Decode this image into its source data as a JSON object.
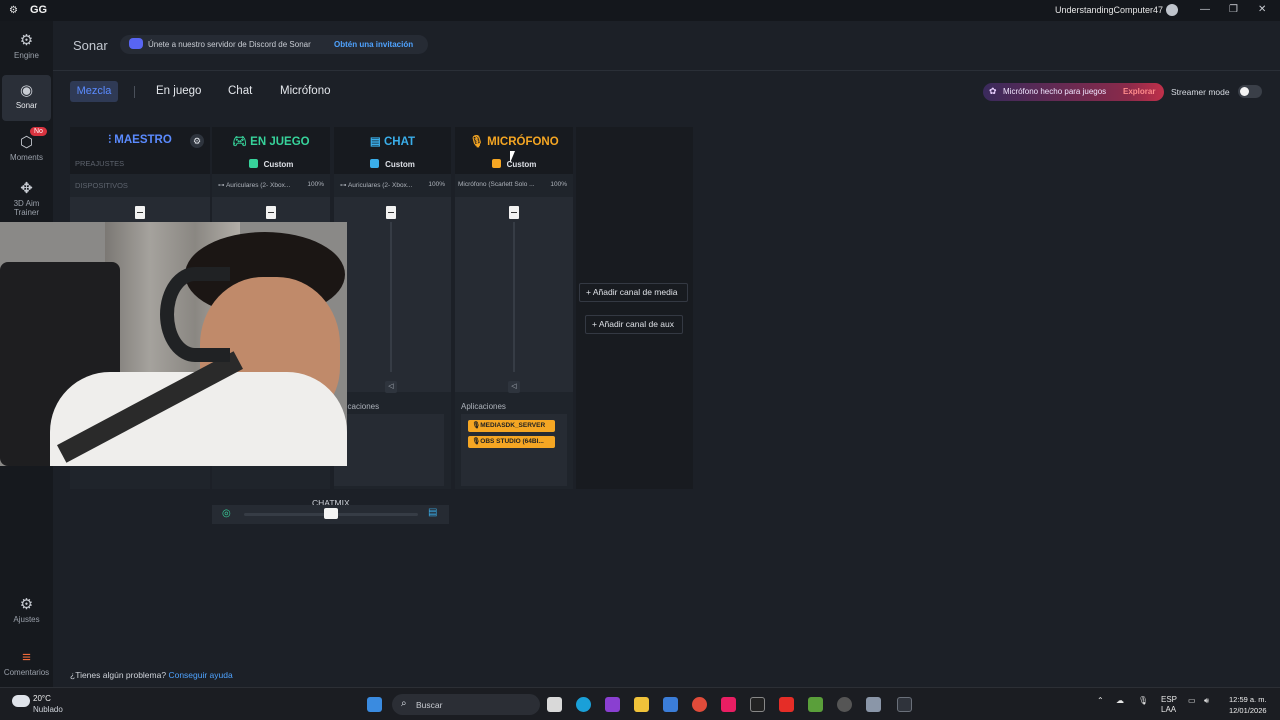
{
  "titlebar": {
    "app": "GG",
    "user": "UnderstandingComputer47"
  },
  "rail": {
    "items": [
      {
        "label": "Engine"
      },
      {
        "label": "Sonar"
      },
      {
        "label": "Moments",
        "badge": "No"
      },
      {
        "label": "3D Aim Trainer"
      },
      {
        "label": "Ajustes"
      },
      {
        "label": "Comentarios"
      }
    ]
  },
  "header": {
    "title": "Sonar",
    "discord_text": "Únete a nuestro servidor de Discord de Sonar",
    "discord_link": "Obtén una invitación"
  },
  "tabs": [
    "Mezcla",
    "En juego",
    "Chat",
    "Micrófono"
  ],
  "promo": {
    "text": "Micrófono hecho para juegos",
    "link": "Explorar"
  },
  "streamer_mode": {
    "label": "Streamer mode",
    "enabled": false
  },
  "mixer": {
    "labels": {
      "presets": "PREAJUSTES",
      "devices": "DISPOSITIVOS",
      "apps": "Aplicaciones",
      "apps_partial": "licaciones"
    },
    "channels": [
      {
        "name": "MAESTRO",
        "color": "#5b8bff",
        "preset": "",
        "device": "",
        "volume": ""
      },
      {
        "name": "EN JUEGO",
        "color": "#37d39b",
        "preset": "Custom",
        "device": "Auriculares (2- Xbox...",
        "volume": "100%"
      },
      {
        "name": "CHAT",
        "color": "#3aaeea",
        "preset": "Custom",
        "device": "Auriculares (2- Xbox...",
        "volume": "100%"
      },
      {
        "name": "MICRÓFONO",
        "color": "#f5a623",
        "preset": "Custom",
        "device": "Micrófono (Scarlett Solo ...",
        "volume": "100%",
        "apps": [
          "MEDIASDK_SERVER",
          "OBS STUDIO (64BI..."
        ]
      }
    ],
    "add_media": "Añadir canal de media",
    "add_aux": "Añadir canal de aux",
    "chatmix_label": "CHATMIX"
  },
  "help": {
    "text": "¿Tienes algún problema?",
    "link": "Conseguir ayuda"
  },
  "taskbar": {
    "temp": "20°C",
    "condition": "Nublado",
    "search_placeholder": "Buscar",
    "lang_top": "ESP",
    "lang_bottom": "LAA",
    "time": "12:59 a. m.",
    "date": "12/01/2026"
  }
}
